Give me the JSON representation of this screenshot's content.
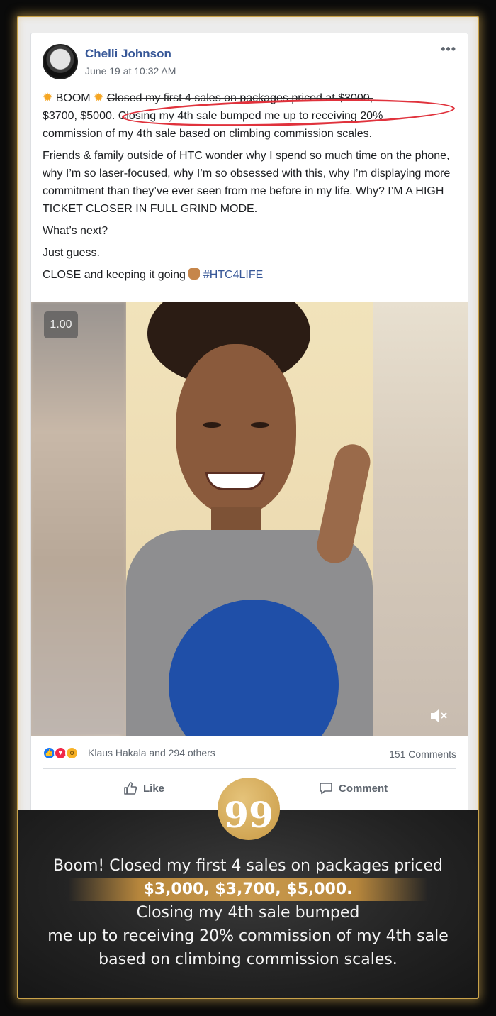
{
  "post": {
    "author": "Chelli Johnson",
    "timestamp": "June 19 at 10:32 AM",
    "more_label": "•••",
    "text": {
      "p1_lead": "BOOM",
      "p1_a": "Closed my first 4 sales on packages priced at $3000,",
      "p1_b": "$3700, $5000. Closing my 4th sale bumped me up to receiving 20%",
      "p1_c": "commission of my 4th sale based on climbing commission scales.",
      "p2": "Friends & family outside of HTC wonder why I spend so much time on the phone, why I’m so laser-focused, why I’m so obsessed with this, why I’m displaying more commitment than they’ve ever seen from me before in my life. Why? I’M A HIGH TICKET CLOSER IN FULL GRIND MODE.",
      "p3": "What’s next?",
      "p4": "Just guess.",
      "p5": "CLOSE and keeping it going",
      "hashtag": "#HTC4LIFE"
    }
  },
  "video": {
    "speed": "1.00",
    "mute_icon": "volume-muted-icon"
  },
  "reactions": {
    "names": "Klaus Hakala and 294 others",
    "comments": "151 Comments"
  },
  "actions": {
    "like": "Like",
    "comment": "Comment"
  },
  "banner": {
    "quote_mark": "99",
    "line1": "Boom! Closed my first 4 sales on packages priced",
    "line2": "$3,000, $3,700, $5,000.",
    "line3": "Closing my 4th sale bumped",
    "line4": "me up to receiving 20% commission of my 4th sale",
    "line5": "based on climbing commission scales."
  },
  "colors": {
    "link_blue": "#385898",
    "gold": "#c99a45",
    "highlight_red": "#e0323c"
  }
}
